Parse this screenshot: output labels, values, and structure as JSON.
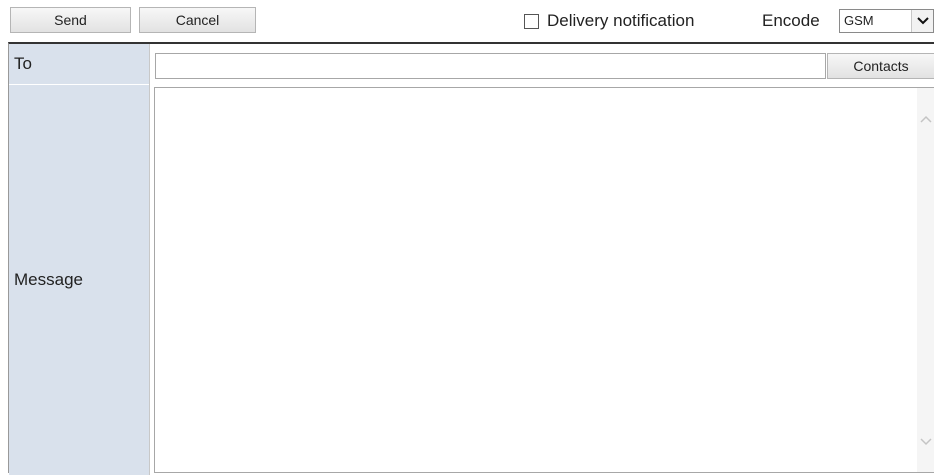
{
  "toolbar": {
    "send_label": "Send",
    "cancel_label": "Cancel",
    "delivery_notification_label": "Delivery notification",
    "delivery_notification_checked": false,
    "encode_label": "Encode",
    "encode_selected": "GSM"
  },
  "form": {
    "to_label": "To",
    "to_value": "",
    "contacts_label": "Contacts",
    "message_label": "Message",
    "message_value": ""
  },
  "icons": {
    "dropdown": "chevron-down-icon",
    "scroll_up": "chevron-up-icon",
    "scroll_down": "chevron-down-icon"
  }
}
